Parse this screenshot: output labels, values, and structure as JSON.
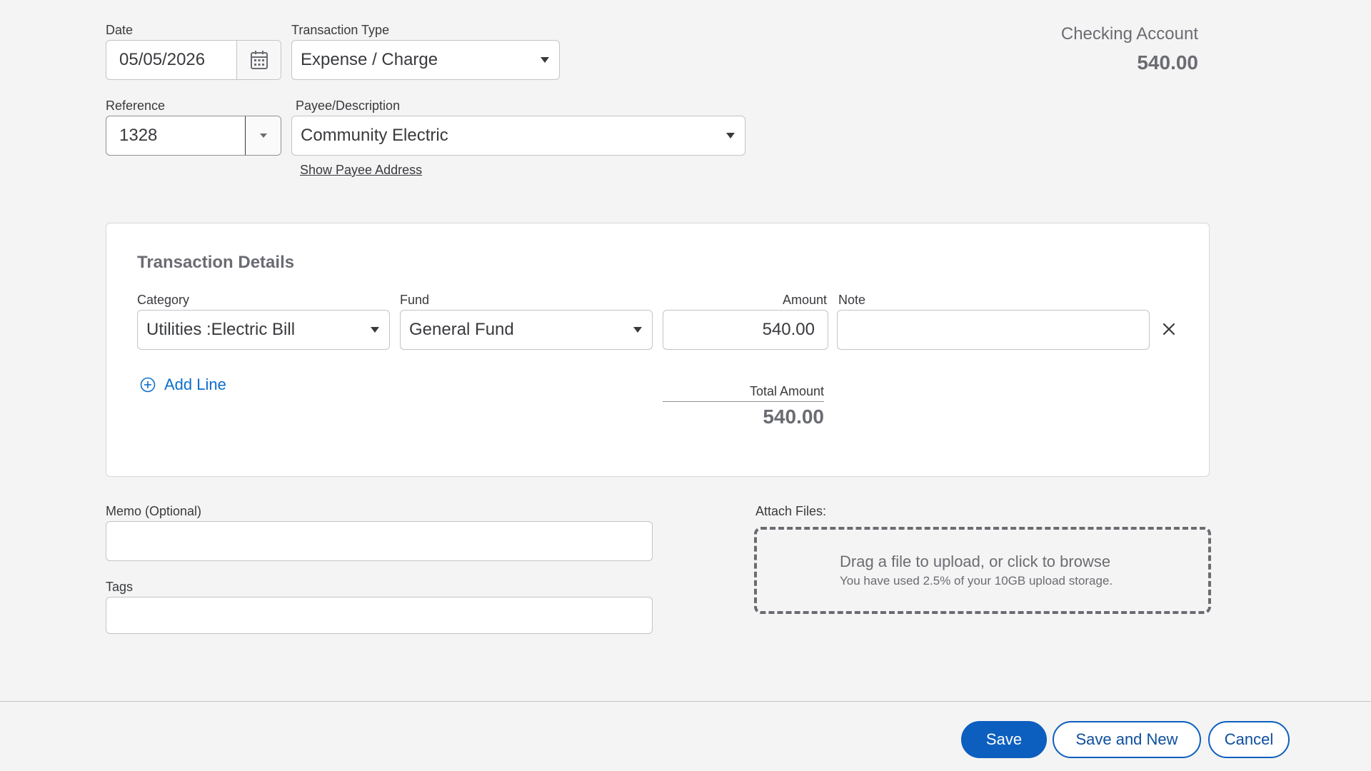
{
  "header": {
    "date": {
      "label": "Date",
      "value": "05/05/2026"
    },
    "transaction_type": {
      "label": "Transaction Type",
      "value": "Expense / Charge"
    },
    "reference": {
      "label": "Reference",
      "value": "1328"
    },
    "payee": {
      "label": "Payee/Description",
      "value": "Community Electric",
      "show_address_link": "Show Payee Address"
    },
    "account": {
      "name": "Checking Account",
      "balance": "540.00"
    }
  },
  "details": {
    "title": "Transaction Details",
    "columns": {
      "category": "Category",
      "fund": "Fund",
      "amount": "Amount",
      "note": "Note"
    },
    "lines": [
      {
        "category": "Utilities :Electric Bill",
        "fund": "General Fund",
        "amount": "540.00",
        "note": ""
      }
    ],
    "add_line_label": "Add Line",
    "total_label": "Total Amount",
    "total_value": "540.00"
  },
  "memo": {
    "label": "Memo (Optional)",
    "value": ""
  },
  "tags": {
    "label": "Tags",
    "value": ""
  },
  "attach": {
    "label": "Attach Files:",
    "main_text": "Drag a file to upload, or click to browse",
    "storage_text": "You have used 2.5% of your 10GB upload storage."
  },
  "footer": {
    "save": "Save",
    "save_and_new": "Save and New",
    "cancel": "Cancel"
  },
  "colors": {
    "primary": "#0d5fbf",
    "link": "#0d6ecb",
    "background": "#f4f4f4"
  }
}
